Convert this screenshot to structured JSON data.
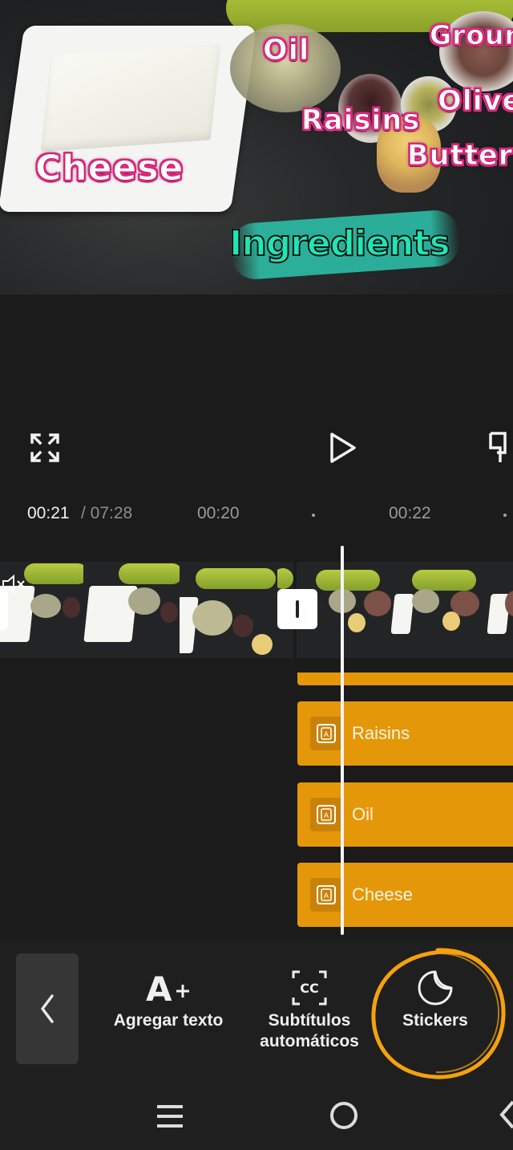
{
  "preview": {
    "stickers": {
      "cheese": "Cheese",
      "oil": "Oil",
      "raisins": "Raisins",
      "olive": "Olive",
      "butter": "Butter",
      "ground": "Groun",
      "ingredients": "Ingredients"
    }
  },
  "player": {
    "fullscreen_icon": "fullscreen-icon",
    "play_icon": "play-icon",
    "crop_icon": "crop-icon"
  },
  "timeline": {
    "current_time": "00:21",
    "total_time": "/ 07:28",
    "markers": [
      "00:20",
      "00:22"
    ],
    "text_tracks": [
      {
        "label": "Raisins"
      },
      {
        "label": "Oil"
      },
      {
        "label": "Cheese"
      }
    ]
  },
  "bottom_toolbar": {
    "back_icon": "chevron-left-icon",
    "tools": [
      {
        "label_line1": "Agregar texto",
        "label_line2": "",
        "icon": "add-text-icon"
      },
      {
        "label_line1": "Subtítulos",
        "label_line2": "automáticos",
        "icon": "captions-icon"
      },
      {
        "label_line1": "Stickers",
        "label_line2": "",
        "icon": "sticker-icon"
      }
    ]
  },
  "colors": {
    "accent_orange": "#e5970a",
    "highlight_circle": "#f5a10f",
    "sticker_pink": "#e22c86",
    "ingredients_teal": "#2cc6ad"
  }
}
